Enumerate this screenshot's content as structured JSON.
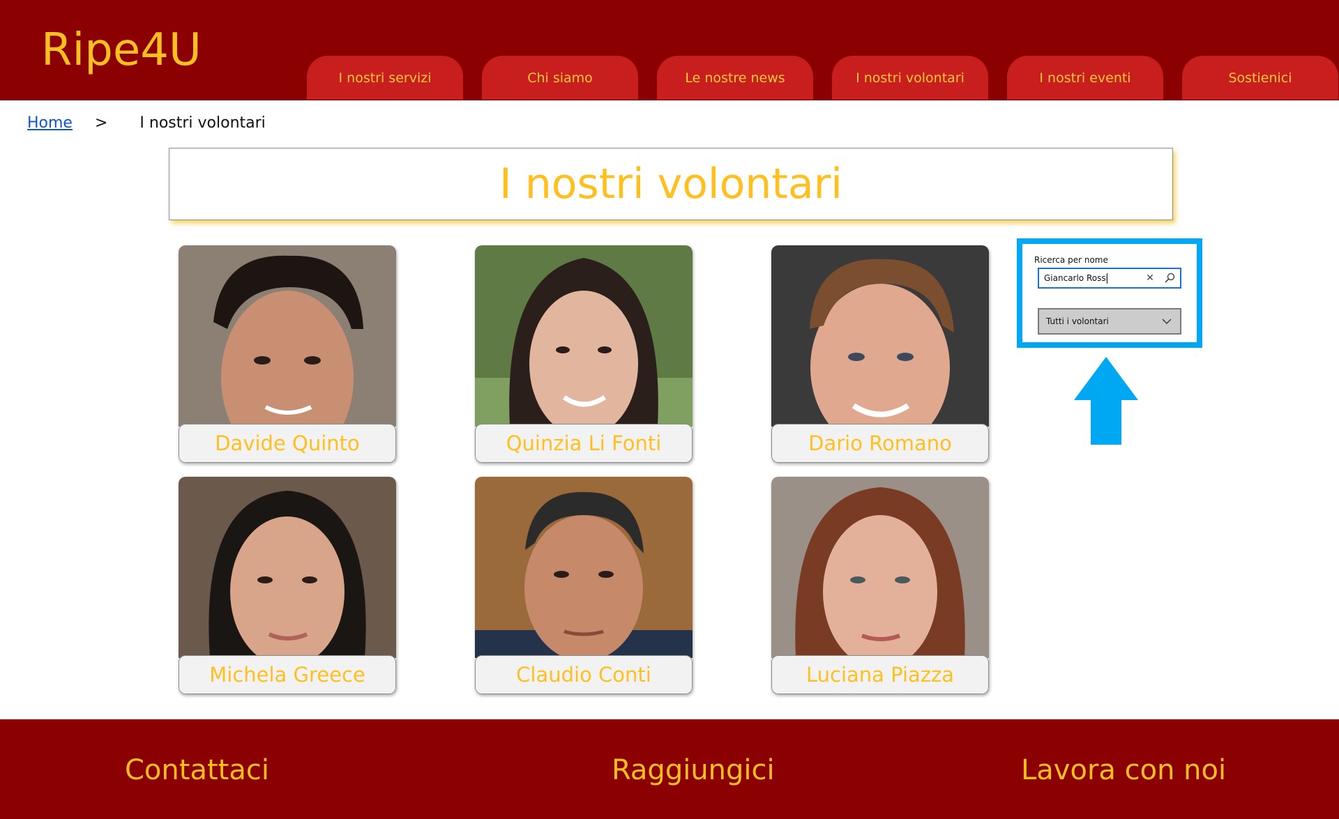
{
  "header": {
    "logo": "Ripe4U",
    "nav": [
      "I nostri servizi",
      "Chi siamo",
      "Le nostre news",
      "I nostri volontari",
      "I nostri eventi",
      "Sostienici"
    ]
  },
  "breadcrumb": {
    "home": "Home",
    "separator": ">",
    "current": "I nostri volontari"
  },
  "page": {
    "title": "I nostri volontari"
  },
  "volunteers": [
    {
      "name": "Davide Quinto"
    },
    {
      "name": "Quinzia Li Fonti"
    },
    {
      "name": "Dario Romano"
    },
    {
      "name": "Michela Greece"
    },
    {
      "name": "Claudio Conti"
    },
    {
      "name": "Luciana Piazza"
    }
  ],
  "search": {
    "label": "Ricerca per nome",
    "value": "Giancarlo Rossi",
    "filter_selected": "Tutti i volontari"
  },
  "footer": {
    "links": [
      "Contattaci",
      "Raggiungici",
      "Lavora con noi"
    ]
  },
  "colors": {
    "brand_dark_red": "#8b0000",
    "tab_red": "#c81e1e",
    "accent_gold": "#ffbf1f",
    "highlight_blue": "#00a8f3"
  }
}
